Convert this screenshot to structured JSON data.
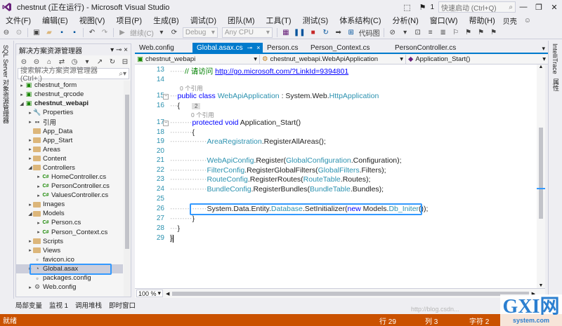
{
  "titlebar": {
    "title": "chestnut (正在运行) - Microsoft Visual Studio",
    "flag_count": "1",
    "quick_launch_placeholder": "快速启动 (Ctrl+Q)",
    "user": "贝壳"
  },
  "menu": [
    "文件(F)",
    "编辑(E)",
    "视图(V)",
    "项目(P)",
    "生成(B)",
    "调试(D)",
    "团队(M)",
    "工具(T)",
    "测试(S)",
    "体系结构(C)",
    "分析(N)",
    "窗口(W)",
    "帮助(H)"
  ],
  "toolbar": {
    "continue_label": "继续(C)",
    "config": "Debug",
    "platform": "Any CPU",
    "codemap_label": "代码图"
  },
  "left_strip": {
    "text": "SQL Server 对象资源管理器"
  },
  "right_strip": {
    "text1": "IntelliTrace",
    "text2": "属性"
  },
  "solution_explorer": {
    "title": "解决方案资源管理器",
    "search_placeholder": "搜索解决方案资源管理器(Ctrl+;)",
    "items": [
      {
        "label": "chestnut_form",
        "level": 1,
        "kind": "project",
        "arrow": "▸"
      },
      {
        "label": "chestnut_qrcode",
        "level": 1,
        "kind": "project",
        "arrow": "▸"
      },
      {
        "label": "chestnut_webapi",
        "level": 1,
        "kind": "project-web",
        "arrow": "◢",
        "bold": true
      },
      {
        "label": "Properties",
        "level": 2,
        "kind": "wrench",
        "arrow": "▸"
      },
      {
        "label": "引用",
        "level": 2,
        "kind": "ref",
        "arrow": "▸"
      },
      {
        "label": "App_Data",
        "level": 2,
        "kind": "folder",
        "arrow": ""
      },
      {
        "label": "App_Start",
        "level": 2,
        "kind": "folder",
        "arrow": "▸"
      },
      {
        "label": "Areas",
        "level": 2,
        "kind": "folder",
        "arrow": "▸"
      },
      {
        "label": "Content",
        "level": 2,
        "kind": "folder",
        "arrow": "▸"
      },
      {
        "label": "Controllers",
        "level": 2,
        "kind": "folder",
        "arrow": "◢"
      },
      {
        "label": "HomeController.cs",
        "level": 3,
        "kind": "cs",
        "arrow": "▸"
      },
      {
        "label": "PersonController.cs",
        "level": 3,
        "kind": "cs",
        "arrow": "▸"
      },
      {
        "label": "ValuesController.cs",
        "level": 3,
        "kind": "cs",
        "arrow": "▸"
      },
      {
        "label": "Images",
        "level": 2,
        "kind": "folder",
        "arrow": "▸"
      },
      {
        "label": "Models",
        "level": 2,
        "kind": "folder",
        "arrow": "◢"
      },
      {
        "label": "Person.cs",
        "level": 3,
        "kind": "cs",
        "arrow": "▸"
      },
      {
        "label": "Person_Context.cs",
        "level": 3,
        "kind": "cs",
        "arrow": "▸"
      },
      {
        "label": "Scripts",
        "level": 2,
        "kind": "folder",
        "arrow": "▸"
      },
      {
        "label": "Views",
        "level": 2,
        "kind": "folder",
        "arrow": "▸"
      },
      {
        "label": "favicon.ico",
        "level": 2,
        "kind": "file",
        "arrow": ""
      },
      {
        "label": "Global.asax",
        "level": 2,
        "kind": "global",
        "arrow": "▸",
        "selected": true
      },
      {
        "label": "packages.config",
        "level": 2,
        "kind": "file",
        "arrow": ""
      },
      {
        "label": "Web.config",
        "level": 2,
        "kind": "config",
        "arrow": "▸"
      }
    ]
  },
  "editor_tabs": [
    {
      "label": "Web.config",
      "active": false,
      "pin": "",
      "close": ""
    },
    {
      "label": "Global.asax.cs",
      "active": true,
      "pin": "⊸",
      "close": "×"
    },
    {
      "label": "Person.cs",
      "active": false,
      "pin": "",
      "close": ""
    },
    {
      "label": "Person_Context.cs",
      "active": false,
      "pin": "",
      "close": ""
    },
    {
      "label": "PersonController.cs",
      "active": false,
      "pin": "",
      "close": ""
    }
  ],
  "nav": {
    "project": "chestnut_webapi",
    "class": "chestnut_webapi.WebApiApplication",
    "member": "Application_Start()"
  },
  "code": {
    "l13": {
      "n": "13",
      "comment": "// 请访问 ",
      "url": "http://go.microsoft.com/?LinkId=9394801"
    },
    "l14": {
      "n": "14"
    },
    "ref1": "0 个引用",
    "l15": {
      "n": "15",
      "t1": "public class ",
      "t2": "WebApiApplication",
      "t3": " : System.Web.",
      "t4": "HttpApplication"
    },
    "l16": {
      "n": "16",
      "t1": "{",
      "badge": "2"
    },
    "ref2": "0 个引用",
    "l17": {
      "n": "17",
      "t1": "protected void ",
      "t2": "Application_Start()"
    },
    "l18": {
      "n": "18",
      "t1": "{"
    },
    "l19": {
      "n": "19",
      "t1": "AreaRegistration",
      "t2": ".RegisterAllAreas();"
    },
    "l20": {
      "n": "20"
    },
    "l21": {
      "n": "21",
      "t1": "WebApiConfig",
      "t2": ".Register(",
      "t3": "GlobalConfiguration",
      "t4": ".Configuration);"
    },
    "l22": {
      "n": "22",
      "t1": "FilterConfig",
      "t2": ".RegisterGlobalFilters(",
      "t3": "GlobalFilters",
      "t4": ".Filters);"
    },
    "l23": {
      "n": "23",
      "t1": "RouteConfig",
      "t2": ".RegisterRoutes(",
      "t3": "RouteTable",
      "t4": ".Routes);"
    },
    "l24": {
      "n": "24",
      "t1": "BundleConfig",
      "t2": ".RegisterBundles(",
      "t3": "BundleTable",
      "t4": ".Bundles);"
    },
    "l25": {
      "n": "25"
    },
    "l26": {
      "n": "26",
      "t1": "System.Data.Entity.",
      "t2": "Database",
      "t3": ".SetInitializer(",
      "t4": "new ",
      "t5": "Models.",
      "t6": "Db_Initer",
      "t7": "());"
    },
    "l27": {
      "n": "27",
      "t1": "}"
    },
    "l28": {
      "n": "28",
      "t1": "}"
    },
    "l29": {
      "n": "29",
      "t1": "}"
    }
  },
  "zoom": "100 %",
  "bottom_tabs": [
    "局部变量",
    "监视 1",
    "调用堆栈",
    "即时窗口"
  ],
  "status": {
    "ready": "就绪",
    "line": "行 29",
    "col": "列 3",
    "char": "字符 2"
  },
  "watermark": {
    "brand": "GXI网",
    "site": "system.com",
    "blog": "http://blog.csdn..."
  }
}
